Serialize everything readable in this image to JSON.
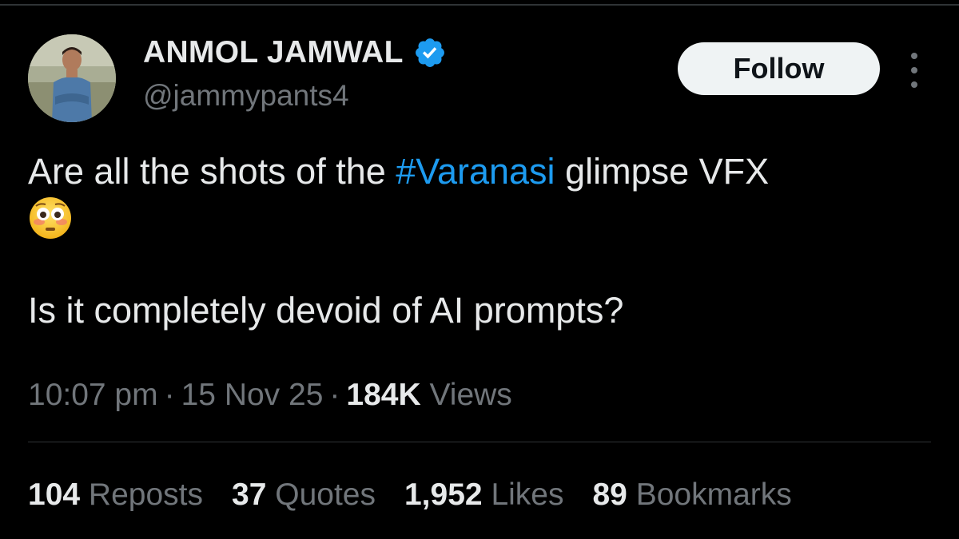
{
  "author": {
    "display_name": "ANMOL JAMWAL",
    "handle": "@jammypants4",
    "verified_icon": "verified-badge-icon",
    "verified_color": "#1d9bf0"
  },
  "follow_label": "Follow",
  "more_icon": "more-options-icon",
  "tweet": {
    "line1_before": "Are all the shots of the ",
    "hashtag": "#Varanasi",
    "line1_after": " glimpse VFX",
    "emoji": "flushed-face-emoji",
    "line3": "Is it completely devoid of AI prompts?"
  },
  "meta": {
    "time": "10:07 pm",
    "separator": "·",
    "date": "15 Nov 25",
    "views_count": "184K",
    "views_label": "Views"
  },
  "stats": [
    {
      "count": "104",
      "label": "Reposts"
    },
    {
      "count": "37",
      "label": "Quotes"
    },
    {
      "count": "1,952",
      "label": "Likes"
    },
    {
      "count": "89",
      "label": "Bookmarks"
    }
  ],
  "colors": {
    "background": "#000000",
    "text": "#e7e9ea",
    "secondary": "#71767b",
    "accent": "#1d9bf0"
  }
}
